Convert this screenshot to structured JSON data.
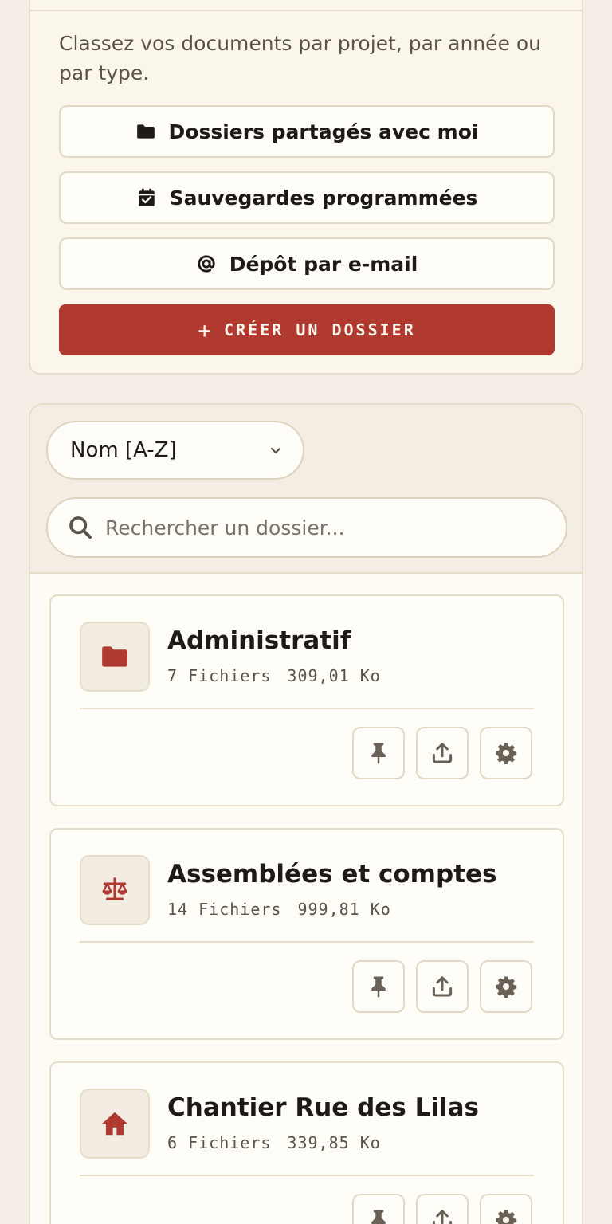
{
  "intro_text": "Classez vos documents par projet, par année ou par type.",
  "options": [
    {
      "label": "Dossiers partagés avec moi",
      "icon": "folder-icon"
    },
    {
      "label": "Sauvegardes programmées",
      "icon": "calendar-check-icon"
    },
    {
      "label": "Dépôt par e-mail",
      "icon": "at-icon"
    }
  ],
  "create_button": {
    "label": "CRÉER UN DOSSIER",
    "icon": "plus-icon"
  },
  "sort": {
    "value": "Nom [A-Z]"
  },
  "search": {
    "placeholder": "Rechercher un dossier..."
  },
  "folders": [
    {
      "name": "Administratif",
      "files": "7 Fichiers",
      "size": "309,01 Ko",
      "icon": "folder-icon"
    },
    {
      "name": "Assemblées et comptes",
      "files": "14 Fichiers",
      "size": "999,81 Ko",
      "icon": "scale-icon"
    },
    {
      "name": "Chantier Rue des Lilas",
      "files": "6 Fichiers",
      "size": "339,85 Ko",
      "icon": "home-icon"
    }
  ],
  "colors": {
    "accent": "#b13a30",
    "background": "#f4eee6",
    "card": "#fffdf7",
    "border": "#e6dcc7"
  }
}
